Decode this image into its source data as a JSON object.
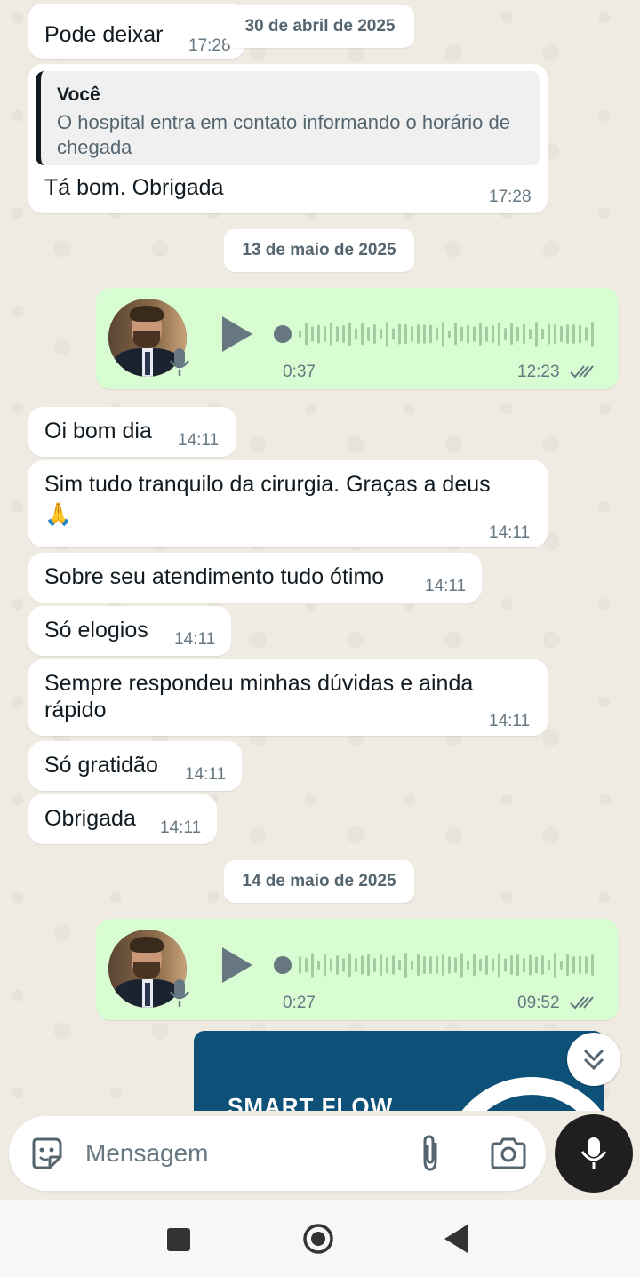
{
  "messages_top": {
    "pode_deixar": {
      "text": "Pode deixar",
      "time": "17:28"
    },
    "date_1": "30 de abril de 2025",
    "reply": {
      "quote_author": "Você",
      "quote_text": "O hospital entra em contato informando o horário de chegada",
      "text": "Tá bom. Obrigada",
      "time": "17:28"
    }
  },
  "date_2": "13 de maio de 2025",
  "voice_1": {
    "duration": "0:37",
    "time": "12:23",
    "status_icon": "double-check-icon"
  },
  "incoming": [
    {
      "text": "Oi bom dia",
      "time": "14:11"
    },
    {
      "text": "Sim tudo tranquilo da cirurgia. Graças a deus",
      "emoji": "🙏",
      "time": "14:11"
    },
    {
      "text": "Sobre seu atendimento tudo ótimo",
      "time": "14:11"
    },
    {
      "text": "Só elogios",
      "time": "14:11"
    },
    {
      "text": "Sempre respondeu minhas dúvidas e ainda",
      "text2": "rápido",
      "time": "14:11"
    },
    {
      "text": "Só gratidão",
      "time": "14:11"
    },
    {
      "text": "Obrigada",
      "time": "14:11"
    }
  ],
  "date_3": "14 de maio de 2025",
  "voice_2": {
    "duration": "0:27",
    "time": "09:52",
    "status_icon": "double-check-icon"
  },
  "image_preview": {
    "brand_text": "SMART FLOW"
  },
  "input": {
    "placeholder": "Mensagem"
  },
  "colors": {
    "outgoing": "#d9fdd3",
    "incoming": "#ffffff",
    "background": "#efeae2",
    "mic_button": "#1f1f1f"
  }
}
